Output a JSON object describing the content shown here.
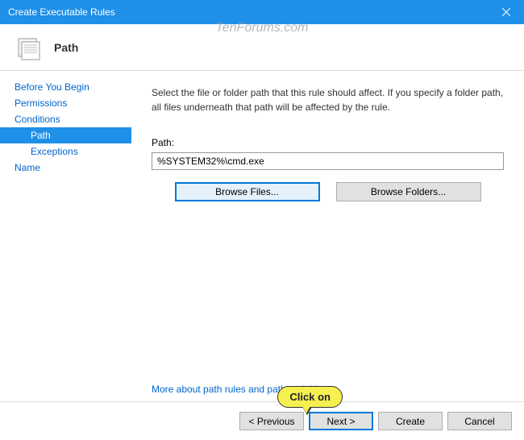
{
  "window": {
    "title": "Create Executable Rules"
  },
  "header": {
    "title": "Path"
  },
  "sidebar": {
    "items": [
      {
        "label": "Before You Begin",
        "selected": false,
        "indent": false
      },
      {
        "label": "Permissions",
        "selected": false,
        "indent": false
      },
      {
        "label": "Conditions",
        "selected": false,
        "indent": false
      },
      {
        "label": "Path",
        "selected": true,
        "indent": true
      },
      {
        "label": "Exceptions",
        "selected": false,
        "indent": true
      },
      {
        "label": "Name",
        "selected": false,
        "indent": false
      }
    ]
  },
  "main": {
    "description": "Select the file or folder path that this rule should affect. If you specify a folder path, all files underneath that path will be affected by the rule.",
    "path_label": "Path:",
    "path_value": "%SYSTEM32%\\cmd.exe",
    "browse_files": "Browse Files...",
    "browse_folders": "Browse Folders...",
    "help_link": "More about path rules and path variables"
  },
  "footer": {
    "previous": "< Previous",
    "next": "Next >",
    "create": "Create",
    "cancel": "Cancel"
  },
  "callout": {
    "text": "Click on"
  },
  "watermark": "TenForums.com"
}
